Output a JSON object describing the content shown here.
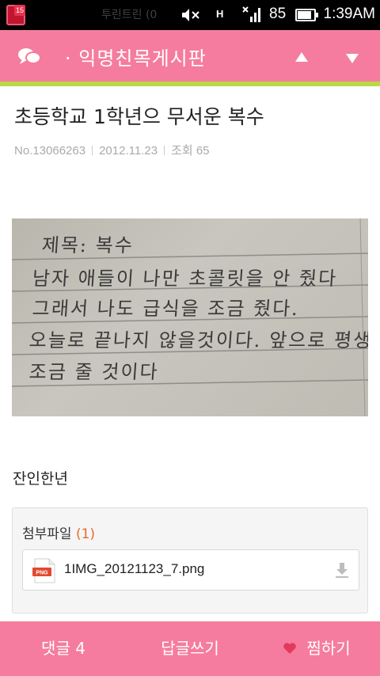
{
  "status_bar": {
    "notification_count": "15",
    "ticker_text": "투린트린 (0",
    "network_type": "H",
    "battery_percent": "85",
    "battery_level": 0.85,
    "time": "1:39AM"
  },
  "header": {
    "board_title": "· 익명친목게시판",
    "icons": [
      "chat-bubble-icon",
      "arrow-up-icon",
      "arrow-down-icon"
    ],
    "accent_color": "#f57c9e",
    "underline_color": "#b9d84a"
  },
  "post": {
    "title": "초등학교 1학년으 무서운 복수",
    "number": "No.13066263",
    "date": "2012.11.23",
    "views": "조회 65",
    "image_text_lines": [
      "제목: 복수",
      "남자 애들이  나만 초콜릿을 안 줬다",
      "그래서 나도 급식을 조금 줬다.",
      "오늘로 끝나지 않을것이다. 앞으로 평생",
      "조금 줄 것이다"
    ],
    "body": "잔인한년"
  },
  "attachments": {
    "label": "첨부파일",
    "count": "(1)",
    "files": [
      {
        "name": "1IMG_20121123_7.png",
        "icon": "png-file-icon",
        "icon_label": "PNG"
      }
    ]
  },
  "bottom_bar": {
    "comments": "댓글 4",
    "reply": "답글쓰기",
    "like": "찜하기"
  }
}
